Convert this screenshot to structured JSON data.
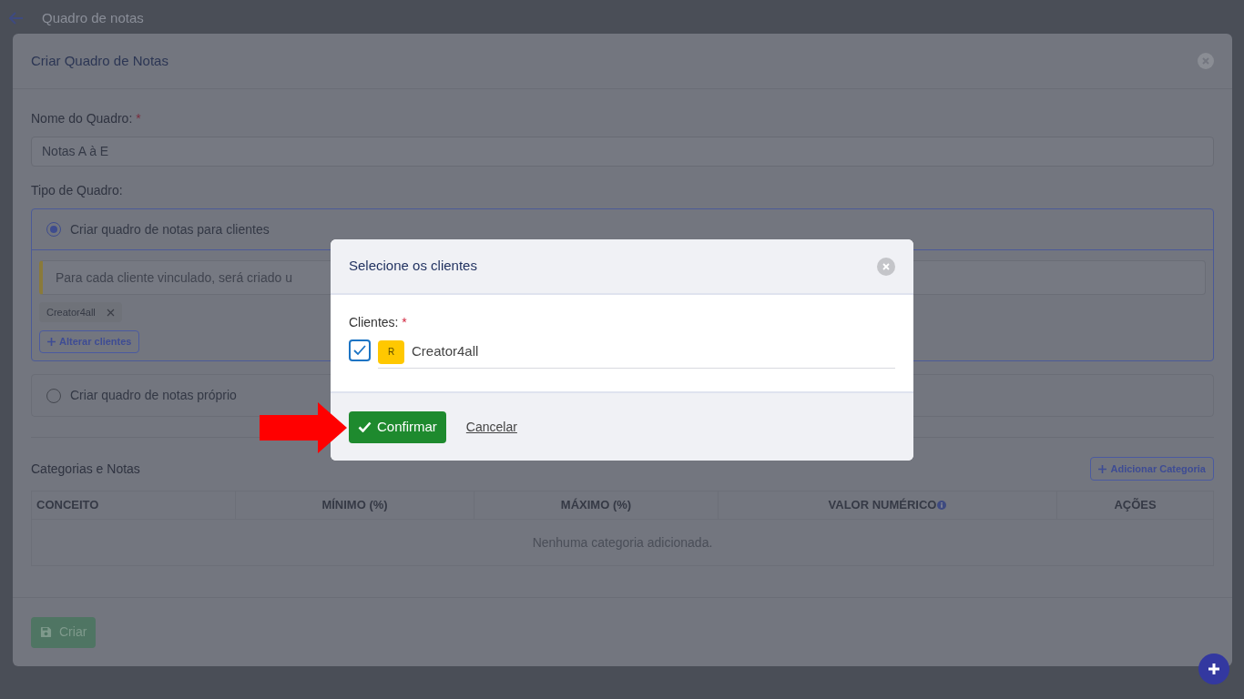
{
  "page": {
    "title": "Quadro de notas"
  },
  "form_dialog": {
    "title": "Criar Quadro de Notas",
    "name_field": {
      "label": "Nome do Quadro:",
      "required_mark": "*",
      "value": "Notas A à E"
    },
    "type_label": "Tipo de Quadro:",
    "type_options": [
      {
        "label": "Criar quadro de notas para clientes",
        "selected": true,
        "note": "Para cada cliente vinculado, será criado u",
        "chips": [
          "Creator4all"
        ],
        "button": "Alterar clientes"
      },
      {
        "label": "Criar quadro de notas próprio",
        "selected": false
      }
    ],
    "categories": {
      "title": "Categorias e Notas",
      "add_button": "Adicionar Categoria",
      "columns": [
        {
          "label": "CONCEITO",
          "info": false
        },
        {
          "label": "MÍNIMO (%)",
          "info": false
        },
        {
          "label": "MÁXIMO (%)",
          "info": false
        },
        {
          "label": "VALOR NUMÉRICO",
          "info": true
        },
        {
          "label": "AÇÕES",
          "info": false
        }
      ],
      "empty_text": "Nenhuma categoria adicionada."
    },
    "create_button": {
      "label": "Criar",
      "disabled": true
    }
  },
  "client_dialog": {
    "title": "Selecione os clientes",
    "field_label": "Clientes:",
    "required_mark": "*",
    "clients": [
      {
        "initial": "R",
        "name": "Creator4all",
        "checked": true
      }
    ],
    "confirm_button": "Confirmar",
    "cancel_link": "Cancelar"
  }
}
